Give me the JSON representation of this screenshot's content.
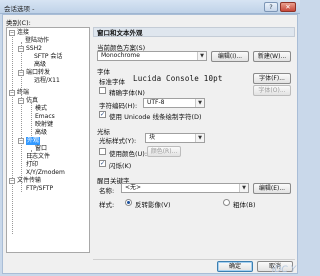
{
  "window": {
    "title": "会话选项 -",
    "help_btn": "?",
    "close_btn": "✕"
  },
  "category": {
    "label": "类别(C):",
    "tree": [
      {
        "label": "连接",
        "expander": "−"
      },
      {
        "label": "登陆动作"
      },
      {
        "label": "SSH2",
        "expander": "−"
      },
      {
        "label": "SFTP 会话"
      },
      {
        "label": "高级"
      },
      {
        "label": "端口转发",
        "expander": "−"
      },
      {
        "label": "远程/X11"
      },
      {
        "label": "终端",
        "expander": "−"
      },
      {
        "label": "仿真",
        "expander": "−"
      },
      {
        "label": "模式"
      },
      {
        "label": "Emacs"
      },
      {
        "label": "映射键"
      },
      {
        "label": "高级"
      },
      {
        "label": "外观",
        "expander": "−"
      },
      {
        "label": "窗口"
      },
      {
        "label": "日志文件"
      },
      {
        "label": "打印"
      },
      {
        "label": "X/Y/Zmodem"
      },
      {
        "label": "文件传输",
        "expander": "−"
      },
      {
        "label": "FTP/SFTP"
      }
    ]
  },
  "panel": {
    "section_title": "窗口和文本外观",
    "color_scheme": {
      "label": "当前颜色方案(S)",
      "value": "Monochrome",
      "edit_btn": "编辑(I)...",
      "new_btn": "新建(W)..."
    },
    "fonts": {
      "group_label": "字体",
      "standard_label": "标准字体",
      "standard_value": "Lucida Console 10pt",
      "font_btn": "字体(F)...",
      "precise_cb": "精确字体(N)",
      "precise_btn": "字体(O)...",
      "encoding_label": "字符编码(H):",
      "encoding_value": "UTF-8",
      "unicode_cb": "使用 Unicode 线条绘制字符(D)"
    },
    "cursor": {
      "group_label": "光标",
      "style_label": "光标样式(Y):",
      "style_value": "块",
      "use_color_cb": "使用颜色(U):",
      "color_btn": "颜色(R)...",
      "blink_cb": "闪烁(K)"
    },
    "keywords": {
      "group_label": "醒目关键字",
      "name_label": "名称:",
      "name_value": "<无>",
      "edit_btn": "编辑(E)...",
      "style_label": "样式:",
      "radio_reverse": "反转影像(V)",
      "radio_bold": "粗体(B)"
    }
  },
  "footer": {
    "ok": "确定",
    "cancel": "取消"
  },
  "watermark": "iDC Y"
}
